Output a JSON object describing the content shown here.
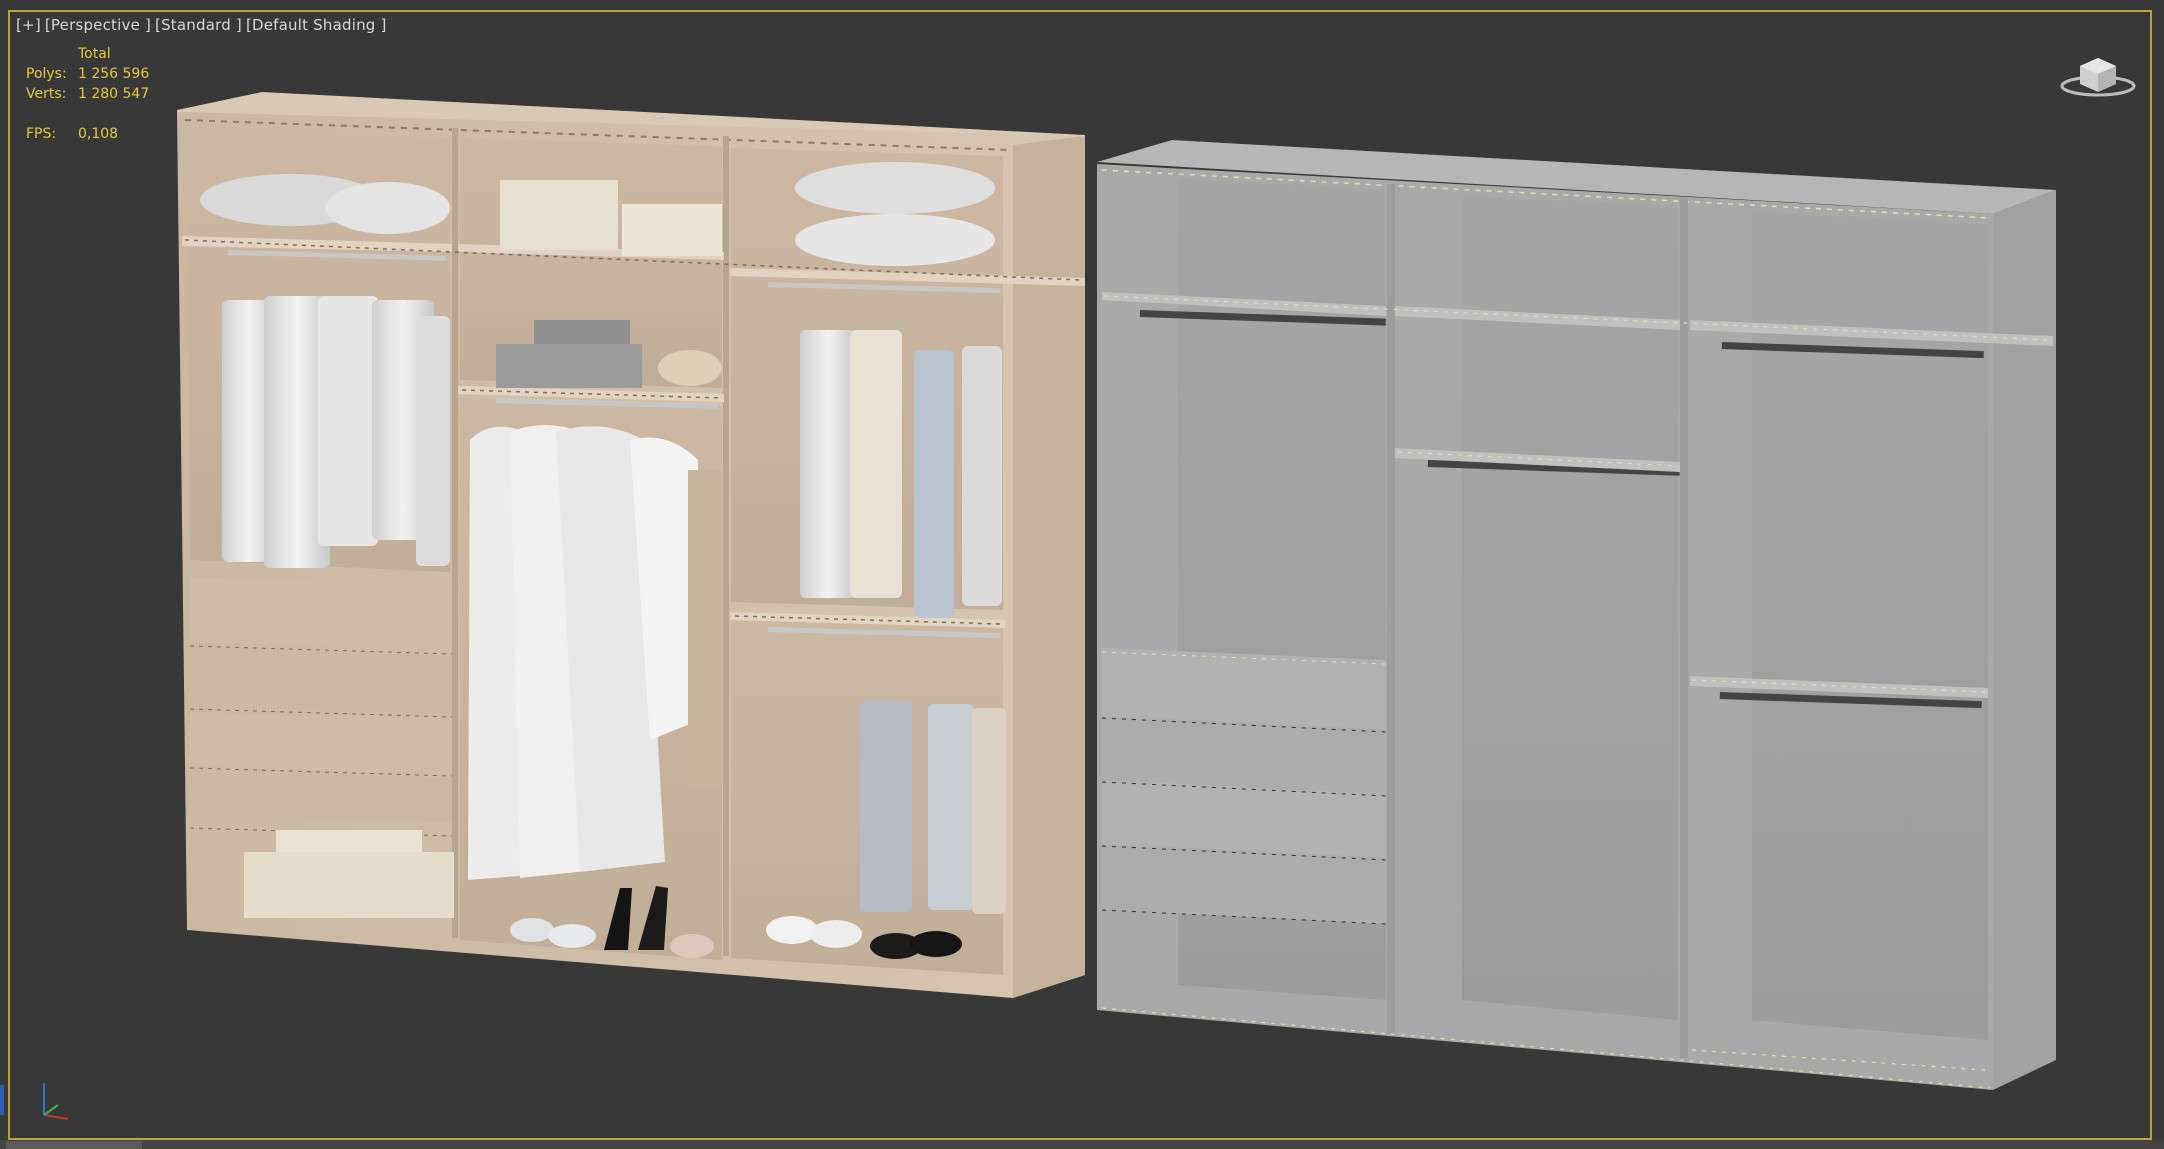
{
  "viewport": {
    "label_plus": "[+]",
    "label_view": "[Perspective ]",
    "label_mode": "[Standard ]",
    "label_shading": "[Default Shading ]"
  },
  "stats": {
    "header": "Total",
    "polys_label": "Polys:",
    "polys_value": "1 256 596",
    "verts_label": "Verts:",
    "verts_value": "1 280 547",
    "fps_label": "FPS:",
    "fps_value": "0,108"
  },
  "icons": {
    "viewcube": "viewcube-icon",
    "axis": "axis-tripod-icon"
  },
  "colors": {
    "border_active": "#b8a43a",
    "stats_text": "#e2c93f",
    "wood": "#cdbba5",
    "grey_model": "#a8a8a8"
  }
}
